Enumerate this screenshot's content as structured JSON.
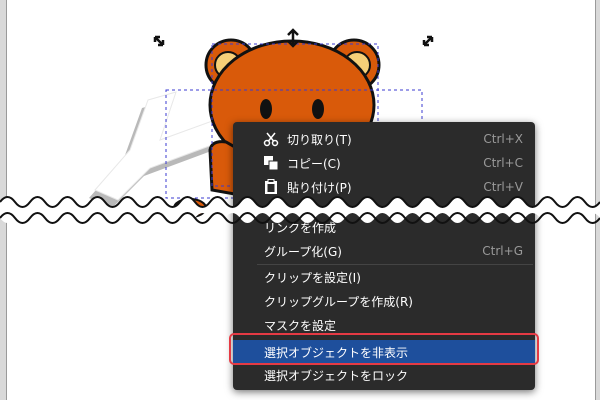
{
  "context_menu": {
    "items": [
      {
        "label": "切り取り(T)",
        "shortcut": "Ctrl+X",
        "icon": "scissors-icon"
      },
      {
        "label": "コピー(C)",
        "shortcut": "Ctrl+C",
        "icon": "copy-icon"
      },
      {
        "label": "貼り付け(P)",
        "shortcut": "Ctrl+V",
        "icon": "paste-icon"
      },
      {
        "label": "リンクを作成",
        "shortcut": ""
      },
      {
        "label": "グループ化(G)",
        "shortcut": "Ctrl+G"
      },
      {
        "label": "クリップを設定(I)",
        "shortcut": ""
      },
      {
        "label": "クリップグループを作成(R)",
        "shortcut": ""
      },
      {
        "label": "マスクを設定",
        "shortcut": ""
      },
      {
        "label": "選択オブジェクトを非表示",
        "shortcut": "",
        "highlighted": true
      },
      {
        "label": "選択オブジェクトをロック",
        "shortcut": ""
      }
    ]
  },
  "colors": {
    "menu_background": "#2b2b2b",
    "menu_highlight": "#1e4f9c",
    "callout_border": "#e53a44",
    "bear_fur": "#d95a0a",
    "bear_ear_inner": "#f5cf78"
  }
}
